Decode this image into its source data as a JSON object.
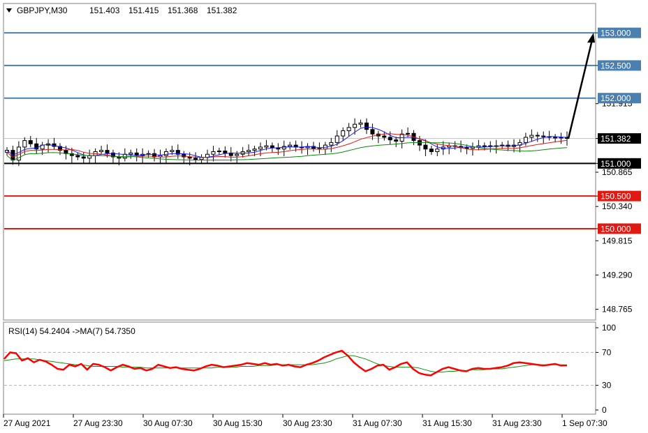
{
  "header": {
    "symbol": "GBPJPY,M30",
    "open": "151.403",
    "high": "151.415",
    "low": "151.368",
    "close": "151.382"
  },
  "rsi_header": {
    "text": "RSI(14) 54.2404  ->MA(7) 54.7350"
  },
  "colors": {
    "resistance": "#4a7fb0",
    "support": "#e01a12",
    "pivot": "#000000",
    "candle": "#000000",
    "ma_fast": "#1a1aff",
    "ma_mid": "#e01a12",
    "ma_slow": "#0a8a0a",
    "rsi": "#ff0000",
    "rsi_ma": "#109010"
  },
  "chart_data": [
    {
      "type": "candlestick",
      "symbol": "GBPJPY",
      "timeframe": "M30",
      "ylim": [
        148.6,
        153.45
      ],
      "y_ticks": [
        "153.000",
        "152.500",
        "151.915",
        "151.382",
        "151.000",
        "150.865",
        "150.500",
        "150.340",
        "150.000",
        "149.815",
        "149.290",
        "148.765"
      ],
      "x_labels": [
        "27 Aug 2021",
        "27 Aug 23:30",
        "30 Aug 07:30",
        "30 Aug 15:30",
        "30 Aug 23:30",
        "31 Aug 07:30",
        "31 Aug 15:30",
        "31 Aug 23:30",
        "1 Sep 07:30"
      ],
      "levels": [
        {
          "value": 153.0,
          "label": "153.000",
          "kind": "resistance"
        },
        {
          "value": 152.5,
          "label": "152.500",
          "kind": "resistance"
        },
        {
          "value": 152.0,
          "label": "152.000",
          "kind": "resistance"
        },
        {
          "value": 151.382,
          "label": "151.382",
          "kind": "current"
        },
        {
          "value": 151.0,
          "label": "151.000",
          "kind": "pivot"
        },
        {
          "value": 150.5,
          "label": "150.500",
          "kind": "support"
        },
        {
          "value": 150.0,
          "label": "150.000",
          "kind": "support"
        }
      ],
      "close_series": [
        151.2,
        151.05,
        151.25,
        151.35,
        151.3,
        151.22,
        151.28,
        151.3,
        151.26,
        151.2,
        151.15,
        151.12,
        151.1,
        151.08,
        151.12,
        151.18,
        151.2,
        151.16,
        151.1,
        151.08,
        151.14,
        151.16,
        151.12,
        151.14,
        151.15,
        151.1,
        151.12,
        151.18,
        151.2,
        151.14,
        151.1,
        151.08,
        151.06,
        151.09,
        151.14,
        151.18,
        151.19,
        151.16,
        151.12,
        151.14,
        151.18,
        151.2,
        151.22,
        151.25,
        151.27,
        151.24,
        151.22,
        151.26,
        151.28,
        151.25,
        151.24,
        151.26,
        151.23,
        151.22,
        151.28,
        151.32,
        151.42,
        151.5,
        151.55,
        151.6,
        151.62,
        151.52,
        151.45,
        151.42,
        151.4,
        151.36,
        151.34,
        151.45,
        151.46,
        151.35,
        151.28,
        151.22,
        151.18,
        151.22,
        151.25,
        151.27,
        151.26,
        151.24,
        151.23,
        151.25,
        151.27,
        151.27,
        151.26,
        151.27,
        151.28,
        151.26,
        151.28,
        151.32,
        151.4,
        151.43,
        151.42,
        151.41,
        151.4,
        151.39,
        151.4,
        151.382
      ],
      "arrow_target": 153.0,
      "moving_averages": 3
    },
    {
      "type": "line",
      "title": "RSI(14) 54.2404  ->MA(7) 54.7350",
      "ylim": [
        0,
        100
      ],
      "y_ticks": [
        100,
        70,
        30,
        0
      ],
      "levels": [
        70,
        30
      ],
      "series": [
        {
          "name": "RSI(14)",
          "values": [
            62,
            70,
            69,
            60,
            63,
            58,
            61,
            59,
            55,
            50,
            49,
            55,
            53,
            56,
            49,
            56,
            55,
            52,
            48,
            52,
            55,
            53,
            50,
            51,
            48,
            50,
            55,
            53,
            51,
            52,
            50,
            49,
            48,
            50,
            53,
            55,
            54,
            52,
            53,
            54,
            55,
            57,
            56,
            55,
            57,
            55,
            56,
            54,
            55,
            53,
            52,
            55,
            57,
            60,
            64,
            67,
            70,
            72,
            66,
            58,
            52,
            47,
            50,
            54,
            55,
            49,
            52,
            56,
            58,
            50,
            45,
            43,
            42,
            46,
            50,
            52,
            50,
            48,
            47,
            50,
            51,
            50,
            50,
            51,
            52,
            54,
            57,
            58,
            57,
            56,
            55,
            54,
            55,
            56,
            54,
            54.24
          ]
        },
        {
          "name": "MA(7)",
          "values": [
            60,
            61,
            62,
            62,
            62,
            62,
            61,
            60,
            59,
            58,
            57,
            56,
            55,
            55,
            54,
            53,
            53,
            53,
            53,
            53,
            52,
            52,
            52,
            52,
            51,
            51,
            51,
            51,
            51,
            51,
            51,
            51,
            51,
            51,
            51,
            51,
            52,
            52,
            52,
            52,
            53,
            53,
            53,
            54,
            54,
            54,
            55,
            55,
            55,
            55,
            55,
            55,
            55,
            56,
            57,
            59,
            62,
            64,
            66,
            66,
            64,
            62,
            59,
            56,
            54,
            53,
            52,
            52,
            52,
            52,
            51,
            49,
            47,
            46,
            46,
            47,
            47,
            48,
            48,
            49,
            49,
            49,
            50,
            50,
            50,
            51,
            52,
            53,
            54,
            55,
            55,
            55,
            55,
            55,
            55,
            54.74
          ]
        }
      ]
    }
  ]
}
